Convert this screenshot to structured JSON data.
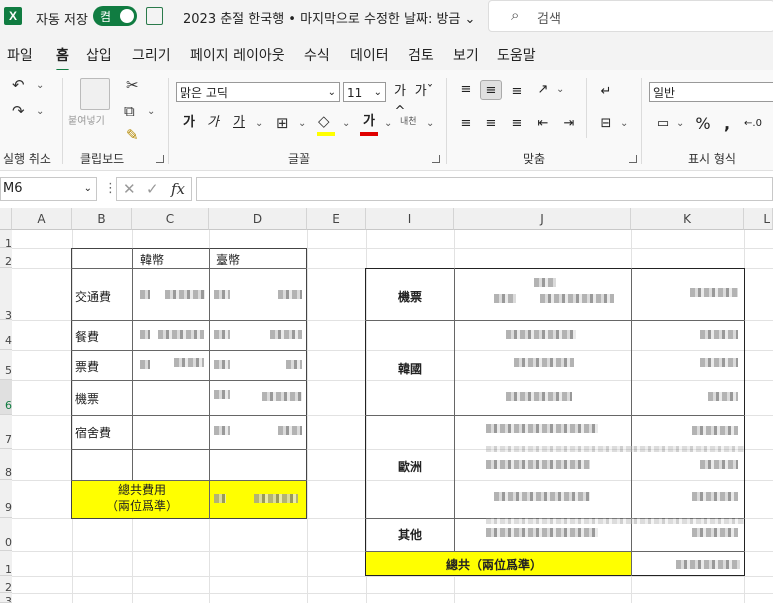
{
  "titlebar": {
    "app_logo": "X",
    "autosave_label": "자동 저장",
    "toggle_label": "켬",
    "document_title": "2023 춘절 한국행 • 마지막으로 수정한 날짜: 방금 ⌄",
    "search_placeholder": "검색"
  },
  "menu": [
    "파일",
    "홈",
    "삽입",
    "그리기",
    "페이지 레이아웃",
    "수식",
    "데이터",
    "검토",
    "보기",
    "도움말"
  ],
  "ribbon": {
    "groups": [
      "실행 취소",
      "클립보드",
      "글꼴",
      "맞춤",
      "표시 형식"
    ],
    "paste_label": "붙여넣기",
    "font_name": "맑은 고딕",
    "font_size": "11",
    "bold": "가",
    "italic": "가",
    "underline": "가",
    "font_color_glyph": "가",
    "number_format": "일반",
    "wrap_label": "내천",
    "grow_font": "가",
    "shrink_font": "가"
  },
  "formula_bar": {
    "name_box": "M6",
    "fx": "fx"
  },
  "columns": [
    "A",
    "B",
    "C",
    "D",
    "E",
    "I",
    "J",
    "K",
    "L"
  ],
  "rows": [
    "1",
    "2",
    "3",
    "4",
    "5",
    "6",
    "7",
    "8",
    "9",
    "0",
    "1",
    "2",
    "3"
  ],
  "left_table": {
    "headers": [
      "韓幣",
      "臺幣"
    ],
    "rows": [
      "交通費",
      "餐費",
      "票費",
      "機票",
      "宿舍費"
    ],
    "total": "總共費用\n（兩位爲準）"
  },
  "right_table": {
    "categories": [
      "機票",
      "韓國",
      "歐洲",
      "其他"
    ],
    "total": "總共（兩位爲準）"
  },
  "colors": {
    "excel_green": "#107c41",
    "highlight": "#ffff00"
  }
}
